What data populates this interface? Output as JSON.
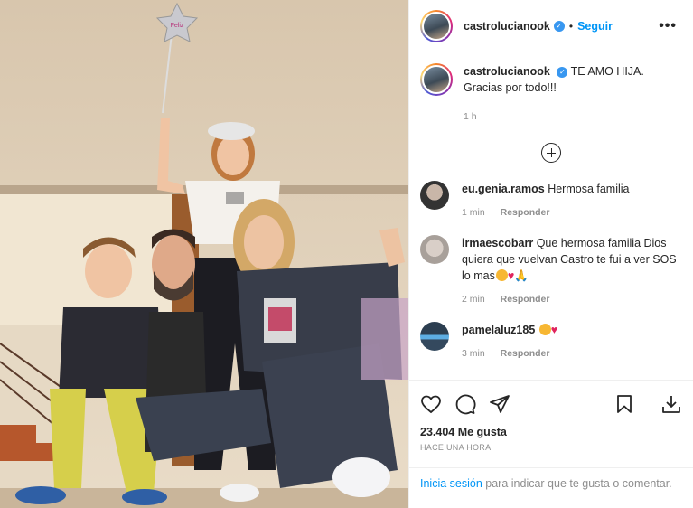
{
  "post_author": {
    "username": "castrolucianook",
    "verified_icon": "verified-badge-icon",
    "separator": "•",
    "follow_label": "Seguir",
    "more_label": "•••"
  },
  "caption": {
    "username": "castrolucianook",
    "text_line1": "TE AMO HIJA.",
    "text_line2": "Gracias por todo!!!",
    "time": "1 h"
  },
  "comments": [
    {
      "username": "eu.genia.ramos",
      "text": "Hermosa familia",
      "time": "1 min",
      "reply": "Responder"
    },
    {
      "username": "irmaescobarr",
      "text": "Que hermosa familia Dios quiera que vuelvan Castro te fui a ver SOS lo mas",
      "time": "2 min",
      "reply": "Responder"
    },
    {
      "username": "pamelaluz185",
      "text": "",
      "time": "3 min",
      "reply": "Responder"
    }
  ],
  "likes_text": "23.404 Me gusta",
  "posted_ago": "HACE UNA HORA",
  "login_prompt": {
    "link": "Inicia sesión",
    "text": " para indicar que te gusta o comentar."
  },
  "balloon_text": "Feliz",
  "colors": {
    "accent": "#0095f6",
    "verified": "#3897f0",
    "muted": "#8e8e8e"
  }
}
